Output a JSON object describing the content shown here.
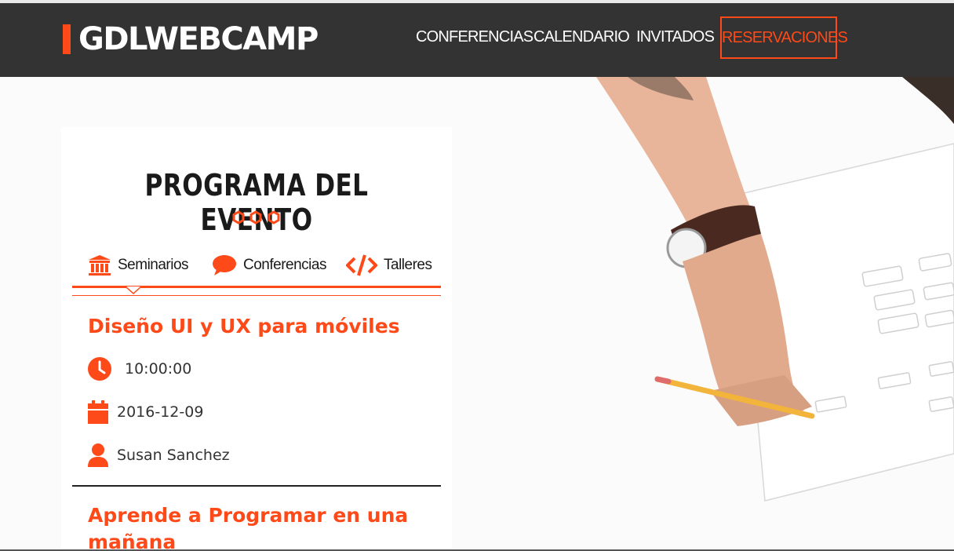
{
  "header": {
    "logo_text": "GDLWEBCAMP",
    "nav": [
      {
        "label": "CONFERENCIAS"
      },
      {
        "label": "CALENDARIO"
      },
      {
        "label": "INVITADOS"
      }
    ],
    "reserve_label": "RESERVACIONES"
  },
  "program": {
    "title": "PROGRAMA DEL EVENTO",
    "tabs": [
      {
        "label": "Seminarios",
        "icon": "bank-icon"
      },
      {
        "label": "Conferencias",
        "icon": "speech-bubble-icon"
      },
      {
        "label": "Talleres",
        "icon": "code-icon"
      }
    ],
    "events": [
      {
        "title": "Diseño UI y UX para móviles",
        "time": "10:00:00",
        "date": "2016-12-09",
        "speaker": "Susan Sanchez"
      },
      {
        "title": "Aprende a Programar en una mañana"
      }
    ]
  },
  "colors": {
    "accent": "#fe4918",
    "header_bg": "#333333",
    "text_dark": "#1a1a1a"
  }
}
